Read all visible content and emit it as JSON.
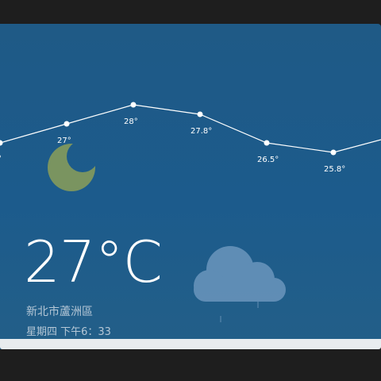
{
  "weather": {
    "current_temp": "27°C",
    "location": "新北市蘆洲區",
    "datetime": "星期四 下午6：33",
    "condition_icon": "cloud-rain-icon",
    "night_icon": "moon-icon"
  },
  "hourly_forecast": {
    "labels": [
      "°",
      "27°",
      "28°",
      "27.8°",
      "26.5°",
      "25.8°"
    ],
    "values": [
      26.4,
      27,
      28,
      27.8,
      26.5,
      25.8
    ]
  },
  "colors": {
    "background_top": "#1f5a86",
    "moon": "#7a9460",
    "cloud": "#6b96bd"
  }
}
